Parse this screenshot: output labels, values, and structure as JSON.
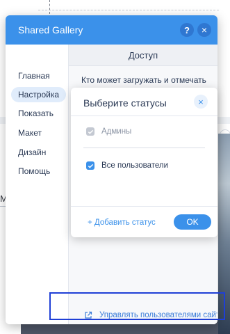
{
  "background": {
    "left_text": "Ma"
  },
  "panel": {
    "title": "Shared Gallery",
    "help_label": "?",
    "close_label": "×",
    "accent_color": "#3b91ea"
  },
  "sidebar": {
    "items": [
      {
        "label": "Главная",
        "active": false
      },
      {
        "label": "Настройка",
        "active": true
      },
      {
        "label": "Показать",
        "active": false
      },
      {
        "label": "Макет",
        "active": false
      },
      {
        "label": "Дизайн",
        "active": false
      },
      {
        "label": "Помощь",
        "active": false
      }
    ]
  },
  "content": {
    "section_title": "Доступ",
    "who_label": "Кто может загружать и отмечать",
    "manage_users_link": "Управлять пользователями сайта",
    "external_link_icon": "external-link-icon"
  },
  "status_popup": {
    "title": "Выберите статусы",
    "close_label": "×",
    "options": [
      {
        "label": "Админы",
        "checked": true,
        "disabled": true
      },
      {
        "label": "Все пользователи",
        "checked": true,
        "disabled": false
      }
    ],
    "add_status": "+ Добавить статус",
    "ok_label": "OK"
  }
}
